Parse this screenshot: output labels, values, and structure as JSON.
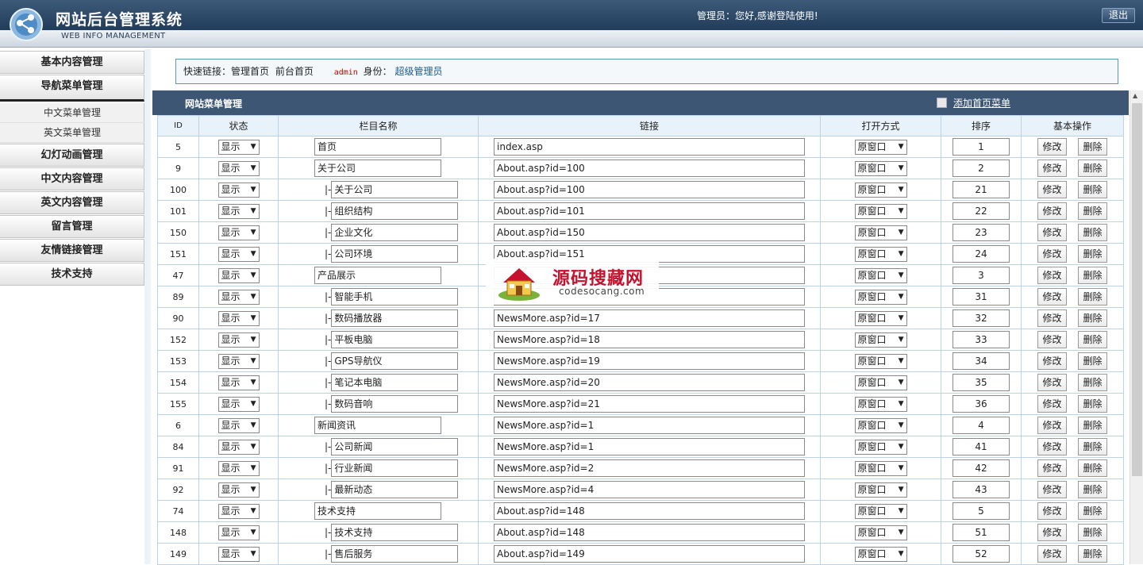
{
  "header": {
    "title": "网站后台管理系统",
    "subtitle": "WEB INFO MANAGEMENT",
    "welcome": "管理员：您好,感谢登陆使用!",
    "logout": "退出"
  },
  "sidebar": {
    "items": [
      {
        "label": "基本内容管理"
      },
      {
        "label": "导航菜单管理",
        "active": true
      },
      {
        "label": "幻灯动画管理"
      },
      {
        "label": "中文内容管理"
      },
      {
        "label": "英文内容管理"
      },
      {
        "label": "留言管理"
      },
      {
        "label": "友情链接管理"
      },
      {
        "label": "技术支持"
      }
    ],
    "subitems": [
      "中文菜单管理",
      "英文菜单管理"
    ]
  },
  "quick": {
    "label": "快速链接：",
    "home": "管理首页",
    "front": "前台首页",
    "admin": "admin",
    "role_label": "身份：",
    "role": "超级管理员"
  },
  "panel": {
    "title": "网站菜单管理",
    "add_link": "添加首页菜单"
  },
  "table": {
    "columns": [
      "ID",
      "状态",
      "栏目名称",
      "链接",
      "打开方式",
      "排序",
      "基本操作"
    ],
    "edit_label": "修改",
    "delete_label": "删除",
    "rows": [
      {
        "id": "5",
        "status": "显示",
        "name": "首页",
        "child": false,
        "link": "index.asp",
        "open": "原窗口",
        "sort": "1"
      },
      {
        "id": "9",
        "status": "显示",
        "name": "关于公司",
        "child": false,
        "link": "About.asp?id=100",
        "open": "原窗口",
        "sort": "2"
      },
      {
        "id": "100",
        "status": "显示",
        "name": "关于公司",
        "child": true,
        "link": "About.asp?id=100",
        "open": "原窗口",
        "sort": "21"
      },
      {
        "id": "101",
        "status": "显示",
        "name": "组织结构",
        "child": true,
        "link": "About.asp?id=101",
        "open": "原窗口",
        "sort": "22"
      },
      {
        "id": "150",
        "status": "显示",
        "name": "企业文化",
        "child": true,
        "link": "About.asp?id=150",
        "open": "原窗口",
        "sort": "23"
      },
      {
        "id": "151",
        "status": "显示",
        "name": "公司环境",
        "child": true,
        "link": "About.asp?id=151",
        "open": "原窗口",
        "sort": "24"
      },
      {
        "id": "47",
        "status": "显示",
        "name": "产品展示",
        "child": false,
        "link": "",
        "open": "原窗口",
        "sort": "3"
      },
      {
        "id": "89",
        "status": "显示",
        "name": "智能手机",
        "child": true,
        "link": "",
        "open": "原窗口",
        "sort": "31"
      },
      {
        "id": "90",
        "status": "显示",
        "name": "数码播放器",
        "child": true,
        "link": "NewsMore.asp?id=17",
        "open": "原窗口",
        "sort": "32"
      },
      {
        "id": "152",
        "status": "显示",
        "name": "平板电脑",
        "child": true,
        "link": "NewsMore.asp?id=18",
        "open": "原窗口",
        "sort": "33"
      },
      {
        "id": "153",
        "status": "显示",
        "name": "GPS导航仪",
        "child": true,
        "link": "NewsMore.asp?id=19",
        "open": "原窗口",
        "sort": "34"
      },
      {
        "id": "154",
        "status": "显示",
        "name": "笔记本电脑",
        "child": true,
        "link": "NewsMore.asp?id=20",
        "open": "原窗口",
        "sort": "35"
      },
      {
        "id": "155",
        "status": "显示",
        "name": "数码音响",
        "child": true,
        "link": "NewsMore.asp?id=21",
        "open": "原窗口",
        "sort": "36"
      },
      {
        "id": "6",
        "status": "显示",
        "name": "新闻资讯",
        "child": false,
        "link": "NewsMore.asp?id=1",
        "open": "原窗口",
        "sort": "4"
      },
      {
        "id": "84",
        "status": "显示",
        "name": "公司新闻",
        "child": true,
        "link": "NewsMore.asp?id=1",
        "open": "原窗口",
        "sort": "41"
      },
      {
        "id": "91",
        "status": "显示",
        "name": "行业新闻",
        "child": true,
        "link": "NewsMore.asp?id=2",
        "open": "原窗口",
        "sort": "42"
      },
      {
        "id": "92",
        "status": "显示",
        "name": "最新动态",
        "child": true,
        "link": "NewsMore.asp?id=4",
        "open": "原窗口",
        "sort": "43"
      },
      {
        "id": "74",
        "status": "显示",
        "name": "技术支持",
        "child": false,
        "link": "About.asp?id=148",
        "open": "原窗口",
        "sort": "5"
      },
      {
        "id": "148",
        "status": "显示",
        "name": "技术支持",
        "child": true,
        "link": "About.asp?id=148",
        "open": "原窗口",
        "sort": "51"
      },
      {
        "id": "149",
        "status": "显示",
        "name": "售后服务",
        "child": true,
        "link": "About.asp?id=149",
        "open": "原窗口",
        "sort": "52"
      }
    ],
    "child_prefix": "|-"
  },
  "watermark": {
    "title": "源码搜藏网",
    "url": "codesocang.com"
  },
  "colors": {
    "header_bg": "#24405e",
    "panel_head": "#3d5673",
    "table_border": "#bcd3e7",
    "admin_red": "#cc0000"
  },
  "icons": [
    "logo-icon",
    "checkbox-icon",
    "dropdown-arrow-icon",
    "scroll-up-icon",
    "house-icon"
  ]
}
